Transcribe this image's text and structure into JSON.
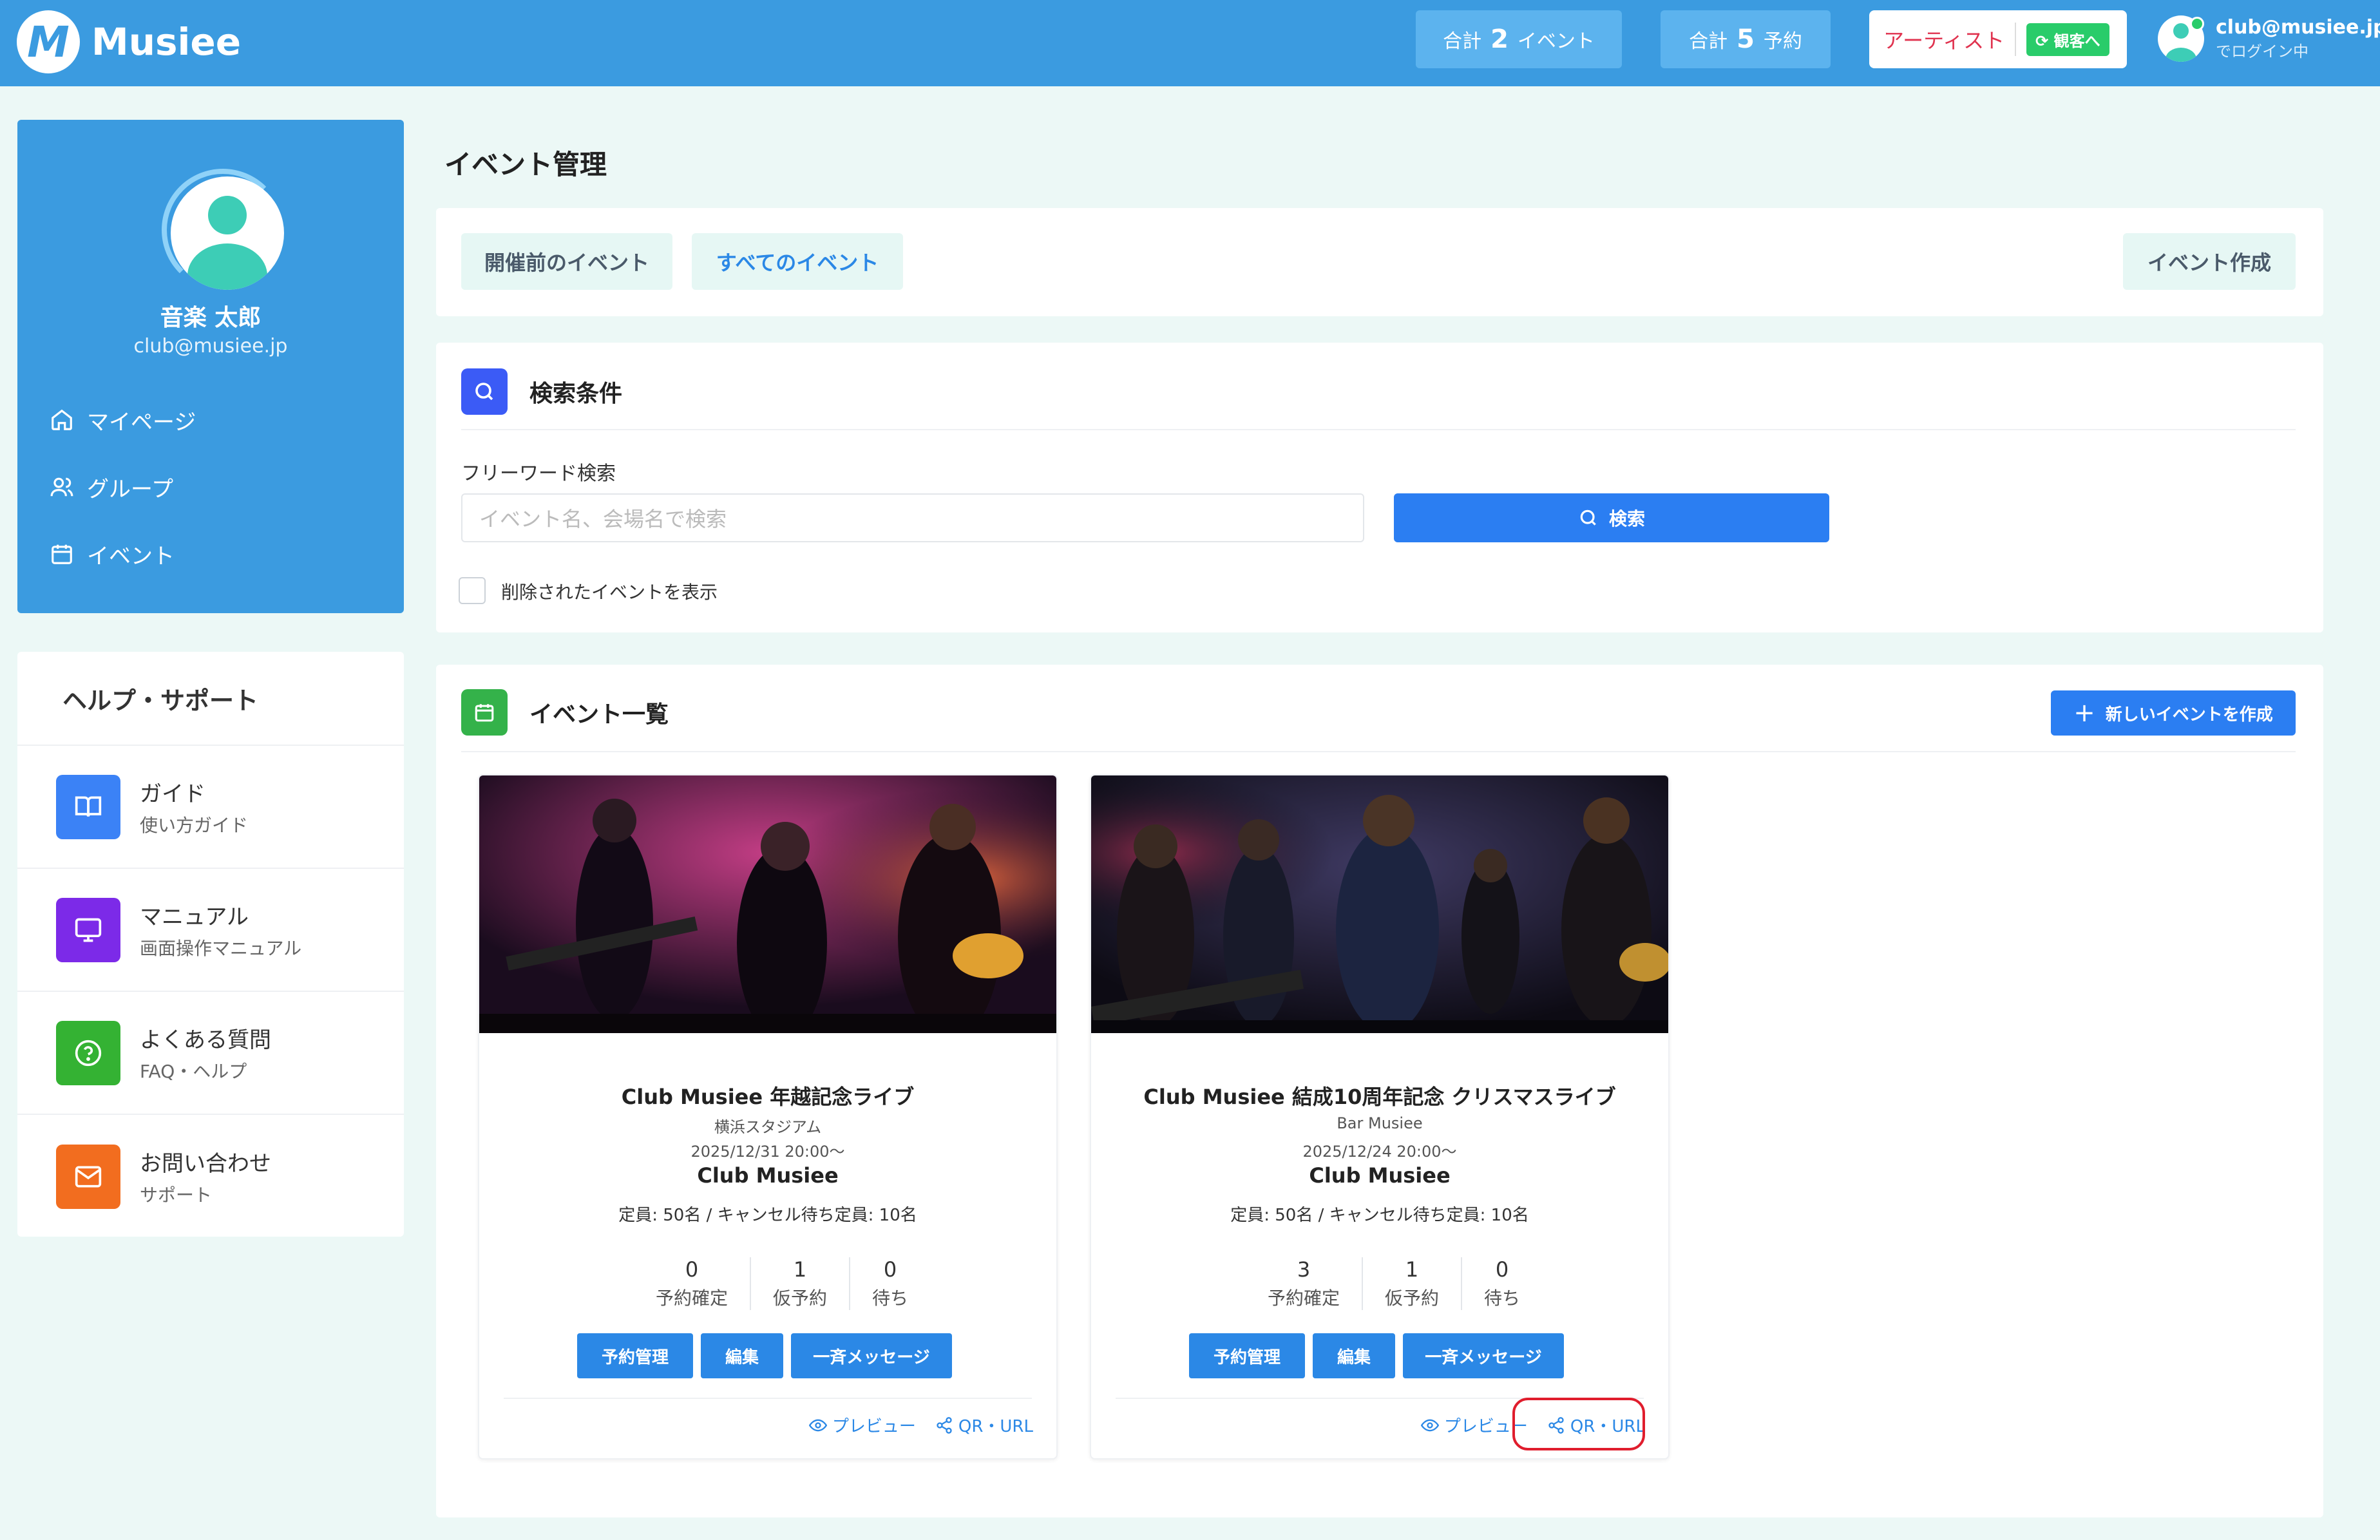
{
  "header": {
    "logo_mark": "M",
    "logo_text": "Musiee",
    "total_events_prefix": "合計",
    "total_events_count": "2",
    "total_events_suffix": "イベント",
    "total_reservations_prefix": "合計",
    "total_reservations_count": "5",
    "total_reservations_suffix": "予約",
    "role_label": "アーティスト",
    "role_switch_label": "観客へ",
    "user_email": "club@musiee.jp",
    "login_status": "でログイン中"
  },
  "profile": {
    "name": "音楽 太郎",
    "email": "club@musiee.jp",
    "nav": [
      {
        "label": "マイページ",
        "icon": "home-icon"
      },
      {
        "label": "グループ",
        "icon": "users-icon"
      },
      {
        "label": "イベント",
        "icon": "calendar-icon"
      }
    ]
  },
  "help": {
    "title": "ヘルプ・サポート",
    "items": [
      {
        "title": "ガイド",
        "subtitle": "使い方ガイド",
        "icon": "book-icon",
        "color": "#3b82f6"
      },
      {
        "title": "マニュアル",
        "subtitle": "画面操作マニュアル",
        "icon": "monitor-icon",
        "color": "#7c2ae8"
      },
      {
        "title": "よくある質問",
        "subtitle": "FAQ・ヘルプ",
        "icon": "question-icon",
        "color": "#34b233"
      },
      {
        "title": "お問い合わせ",
        "subtitle": "サポート",
        "icon": "mail-icon",
        "color": "#f26d1f"
      }
    ]
  },
  "main": {
    "page_title": "イベント管理",
    "tabs": {
      "upcoming": "開催前のイベント",
      "all": "すべてのイベント",
      "create": "イベント作成"
    },
    "search": {
      "title": "検索条件",
      "freeword_label": "フリーワード検索",
      "placeholder": "イベント名、会場名で検索",
      "button": "検索",
      "show_deleted_label": "削除されたイベントを表示"
    },
    "list": {
      "title": "イベント一覧",
      "new_button": "新しいイベントを作成"
    }
  },
  "events": [
    {
      "title": "Club Musiee 年越記念ライブ",
      "venue": "横浜スタジアム",
      "date": "2025/12/31 20:00〜",
      "organizer": "Club Musiee",
      "capacity": "定員: 50名 / キャンセル待ち定員: 10名",
      "stats": [
        {
          "value": "0",
          "label": "予約確定"
        },
        {
          "value": "1",
          "label": "仮予約"
        },
        {
          "value": "0",
          "label": "待ち"
        }
      ],
      "buttons": {
        "manage": "予約管理",
        "edit": "編集",
        "message": "一斉メッセージ"
      },
      "links": {
        "preview": "プレビュー",
        "qr": "QR・URL"
      }
    },
    {
      "title": "Club Musiee 結成10周年記念 クリスマスライブ",
      "venue": "Bar Musiee",
      "date": "2025/12/24 20:00〜",
      "organizer": "Club Musiee",
      "capacity": "定員: 50名 / キャンセル待ち定員: 10名",
      "stats": [
        {
          "value": "3",
          "label": "予約確定"
        },
        {
          "value": "1",
          "label": "仮予約"
        },
        {
          "value": "0",
          "label": "待ち"
        }
      ],
      "buttons": {
        "manage": "予約管理",
        "edit": "編集",
        "message": "一斉メッセージ"
      },
      "links": {
        "preview": "プレビュー",
        "qr": "QR・URL"
      }
    }
  ],
  "colors": {
    "header_bg": "#3b9be0",
    "page_bg": "#ecf8f6",
    "primary_button": "#2b7ef2",
    "highlight": "#e01d2d"
  }
}
